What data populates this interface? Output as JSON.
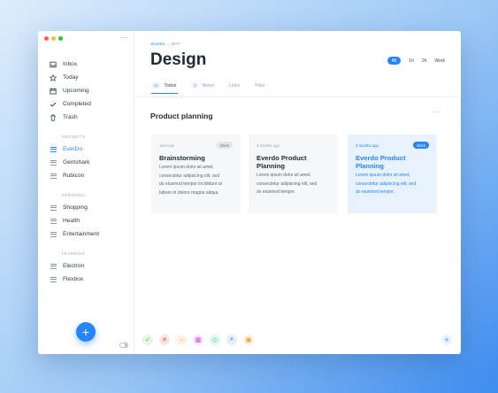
{
  "sidebar": {
    "main_items": [
      {
        "label": "Inbox",
        "icon": "inbox-icon"
      },
      {
        "label": "Today",
        "icon": "star-icon"
      },
      {
        "label": "Upcoming",
        "icon": "calendar-icon"
      },
      {
        "label": "Completed",
        "icon": "check-icon"
      },
      {
        "label": "Trash",
        "icon": "trash-icon"
      }
    ],
    "sections": [
      {
        "title": "PROJECTS",
        "items": [
          "EverDo",
          "Gemshark",
          "Rubicon"
        ]
      },
      {
        "title": "PERSONAL",
        "items": [
          "Shopping",
          "Health",
          "Entertainment"
        ]
      },
      {
        "title": "LEARNING",
        "items": [
          "Electron",
          "Flexbox"
        ]
      }
    ],
    "active_project": "EverDo",
    "fab_label": "+"
  },
  "header": {
    "breadcrumb_project": "EverDo",
    "breadcrumb_sep": "→",
    "breadcrumb_current": "MVP",
    "title": "Design",
    "filters": [
      "All",
      "1h",
      "2h",
      "Work"
    ],
    "active_filter": "All"
  },
  "tabs": [
    {
      "count": "10",
      "label": "Todos"
    },
    {
      "count": "3",
      "label": "Notes"
    },
    {
      "count": "",
      "label": "Links"
    },
    {
      "count": "",
      "label": "Files"
    }
  ],
  "section": {
    "title": "Product planning",
    "more": "···"
  },
  "cards": [
    {
      "meta": "Just now",
      "badge": "Work",
      "title": "Brainstorming",
      "lines": [
        "Lorem ipsum dolor sit amet,",
        "consectetur adipiscing elit, sed",
        "do eiusmod tempor incididunt ut",
        "labore et dolore magna aliqua."
      ]
    },
    {
      "meta": "3 months ago",
      "badge": "",
      "title": "Everdo Product Planning",
      "lines": [
        "Lorem ipsum dolor sit amet,",
        "consectetur adipiscing elit, sed",
        "do eiusmod tempor."
      ]
    },
    {
      "meta": "3 months ago",
      "badge": "Work",
      "title": "Everdo Product Planning",
      "lines": [
        "Lorem ipsum dolor sit amet,",
        "consectetur adipiscing elit, sed",
        "do eiusmod tempor."
      ]
    }
  ],
  "toolbar": {
    "actions": [
      {
        "icon": "check-icon",
        "glyph": "✓",
        "bg": "#e6f6e3",
        "fg": "#3fae3a"
      },
      {
        "icon": "close-icon",
        "glyph": "✕",
        "bg": "#fde6e6",
        "fg": "#e04848"
      },
      {
        "icon": "forward-icon",
        "glyph": "›",
        "bg": "#fff0de",
        "fg": "#f29a2e"
      },
      {
        "icon": "calendar-icon",
        "glyph": "▦",
        "bg": "#f7e6fb",
        "fg": "#c750e0"
      },
      {
        "icon": "tag-icon",
        "glyph": "◇",
        "bg": "#dff5ef",
        "fg": "#2db38a"
      },
      {
        "icon": "search-icon",
        "glyph": "⌕",
        "bg": "#e3edfb",
        "fg": "#3b5e8c"
      },
      {
        "icon": "archive-icon",
        "glyph": "▣",
        "bg": "#fff0de",
        "fg": "#f29a2e"
      }
    ],
    "add_label": "+"
  },
  "colors": {
    "accent": "#2684ff"
  }
}
